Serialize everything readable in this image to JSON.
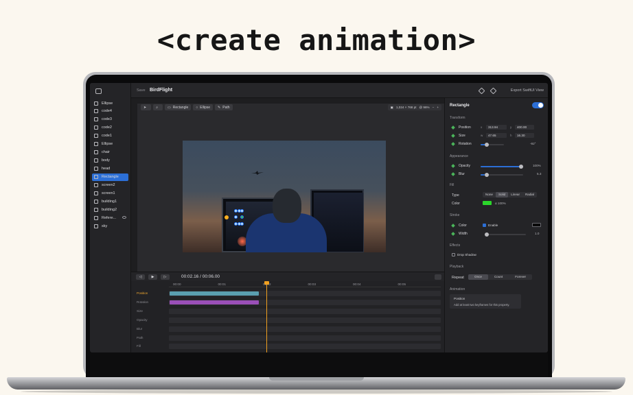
{
  "headline": "<create animation>",
  "toolbar": {
    "save_label": "Save",
    "doc_name": "BirdFlight",
    "export_label": "Export SwiftUI View"
  },
  "layers": [
    {
      "label": "Ellipse"
    },
    {
      "label": "code4"
    },
    {
      "label": "code3"
    },
    {
      "label": "code2"
    },
    {
      "label": "code1"
    },
    {
      "label": "Ellipse"
    },
    {
      "label": "chair"
    },
    {
      "label": "body"
    },
    {
      "label": "head"
    },
    {
      "label": "Rectangle",
      "selected": true
    },
    {
      "label": "screen2"
    },
    {
      "label": "screen1"
    },
    {
      "label": "building1"
    },
    {
      "label": "building2"
    },
    {
      "label": "Refere..."
    },
    {
      "label": "sky"
    }
  ],
  "tools": {
    "rectangle": "Rectangle",
    "ellipse": "Ellipse",
    "path": "Path"
  },
  "canvas_info": {
    "size": "1,024 × 768 pt",
    "zoom": "@ 96%"
  },
  "playback": {
    "current": "00:02.16",
    "separator": "/",
    "total": "00:06.00"
  },
  "timeline": {
    "ticks": [
      "00:00",
      "00:01",
      "00:02",
      "00:03",
      "00:04",
      "00:05"
    ],
    "tracks": [
      {
        "label": "Position",
        "active": true,
        "bar_color": "#5a9fb0"
      },
      {
        "label": "Rotation",
        "bar_color": "#9a4fb8"
      },
      {
        "label": "Size"
      },
      {
        "label": "Opacity"
      },
      {
        "label": "Blur"
      },
      {
        "label": "Path"
      },
      {
        "label": "Fill"
      }
    ]
  },
  "inspector": {
    "title": "Rectangle",
    "transform": {
      "section": "Transform",
      "position": {
        "label": "Position",
        "x_axis": "x",
        "x": "313.94",
        "y_axis": "y",
        "y": "400.00"
      },
      "size": {
        "label": "Size",
        "w_axis": "w",
        "w": "47.65",
        "h_axis": "h",
        "h": "16.30"
      },
      "rotation": {
        "label": "Rotation",
        "value": "-92°",
        "fraction": 0.22
      }
    },
    "appearance": {
      "section": "Appearance",
      "opacity": {
        "label": "Opacity",
        "value": "100%",
        "fraction": 1.0
      },
      "blur": {
        "label": "Blur",
        "value": "5.3",
        "fraction": 0.1
      }
    },
    "fill": {
      "section": "Fill",
      "type_label": "Type",
      "types": [
        "None",
        "Solid",
        "Linear",
        "Radial"
      ],
      "selected_type": "Solid",
      "color_label": "Color",
      "color": "#2bd62b",
      "opacity_text": "α 100%"
    },
    "stroke": {
      "section": "Stroke",
      "color_label": "Color",
      "enable_label": "Enable",
      "color": "#0a0a0a",
      "width_label": "Width",
      "width": "1.0",
      "width_fraction": 0.0
    },
    "effects": {
      "section": "Effects",
      "drop_shadow": "Drop Shadow"
    },
    "playback": {
      "section": "Playback",
      "repeat_label": "Repeat",
      "options": [
        "Once",
        "Count",
        "Forever"
      ],
      "selected": "Once"
    },
    "animation": {
      "section": "Animation",
      "property": "Position",
      "hint": "Add at least two keyframes for this property."
    }
  }
}
